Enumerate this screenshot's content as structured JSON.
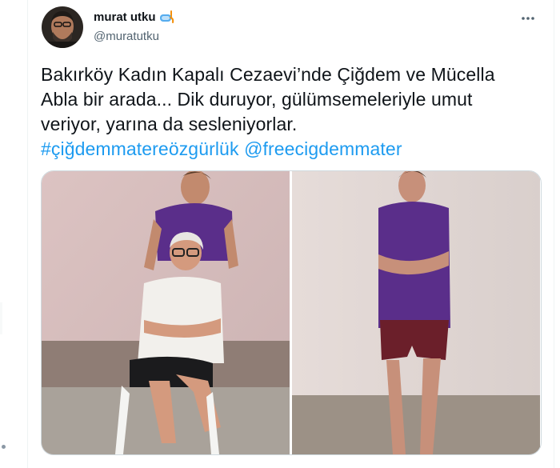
{
  "tweet": {
    "author": {
      "display_name": "murat utku",
      "handle": "@muratutku",
      "emoji_icon": "diving-mask-icon"
    },
    "more_icon": "more-dots-icon",
    "text_line_1": "Bakırköy Kadın Kapalı Cezaevi’nde Çiğdem ve Mücella",
    "text_line_2": "Abla bir arada... Dik duruyor, gülümsemeleriyle umut",
    "text_line_3": "veriyor, yarına da sesleniyorlar.",
    "hashtag_1": "#çiğdemmatereözgürlük",
    "mention_1": "@freecigdemmater",
    "media": [
      {
        "subject": "two women posing against wall, one seated"
      },
      {
        "subject": "woman standing against wall, arms crossed"
      }
    ]
  },
  "colors": {
    "text": "#0f1419",
    "secondary": "#536471",
    "link": "#1d9bf0",
    "border": "#cfd9de"
  }
}
